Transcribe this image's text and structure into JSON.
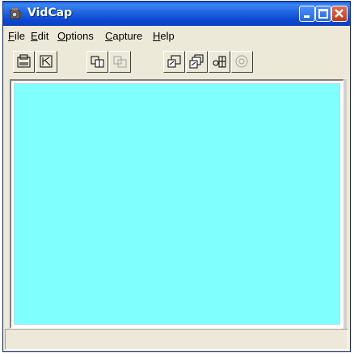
{
  "window": {
    "title": "VidCap"
  },
  "menu": {
    "items": [
      {
        "label": "File",
        "accel": "F"
      },
      {
        "label": "Edit",
        "accel": "E"
      },
      {
        "label": "Options",
        "accel": "O"
      },
      {
        "label": "Capture",
        "accel": "C"
      },
      {
        "label": "Help",
        "accel": "H"
      }
    ]
  },
  "toolbar": {
    "buttons": [
      {
        "icon": "set-capture-file-icon"
      },
      {
        "icon": "save-captured-video-icon"
      },
      {
        "icon": "capture-frame-icon"
      },
      {
        "icon": "capture-frames-icon"
      },
      {
        "icon": "capture-video-icon"
      },
      {
        "icon": "capture-sequence-icon"
      },
      {
        "icon": "capture-palette-icon"
      },
      {
        "icon": "help-icon"
      }
    ]
  },
  "colors": {
    "titlebar": "#0a4ad4",
    "capture_area": "#80ffff"
  },
  "status": {
    "text": ""
  }
}
